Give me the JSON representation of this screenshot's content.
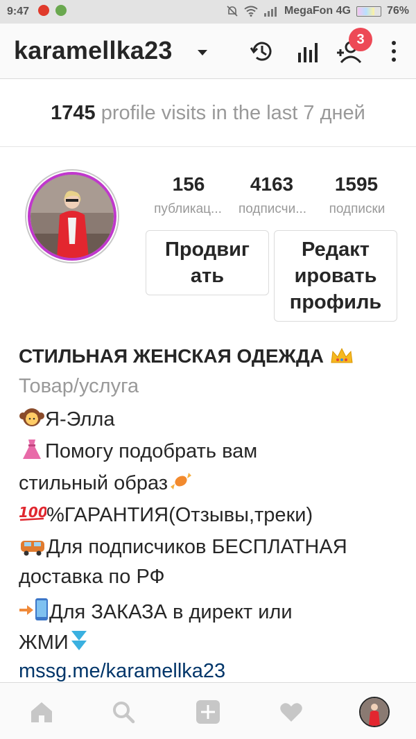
{
  "status_bar": {
    "time": "9:47",
    "carrier": "MegaFon 4G",
    "battery": "76%",
    "icons": [
      "yandex-app-icon",
      "app-icon",
      "mute-icon",
      "wifi-icon",
      "signal-icon",
      "battery-icon"
    ]
  },
  "header": {
    "username": "karamellka23",
    "notification_count": "3",
    "icons": [
      "chevron-down-icon",
      "history-icon",
      "insights-icon",
      "add-user-icon",
      "more-icon"
    ]
  },
  "visits": {
    "count": "1745",
    "text": "profile visits in the last 7 дней"
  },
  "stats": [
    {
      "value": "156",
      "label": "публикац..."
    },
    {
      "value": "4163",
      "label": "подписчи..."
    },
    {
      "value": "1595",
      "label": "подписки"
    }
  ],
  "buttons": {
    "promote_line1": "Продвиг",
    "promote_line2": "ать",
    "edit_line1": "Редакт",
    "edit_line2": "ировать",
    "edit_line3": "профиль"
  },
  "bio": {
    "name": "СТИЛЬНАЯ ЖЕНСКАЯ ОДЕЖДА",
    "category": "Товар/услуга",
    "lines": [
      "Я-Элла",
      "Помогу подобрать вам",
      "стильный образ",
      "%ГАРАНТИЯ(Отзывы,треки)",
      "Для подписчиков БЕСПЛАТНАЯ",
      "доставка по РФ",
      "Для ЗАКАЗА в директ или",
      "ЖМИ"
    ],
    "link": "mssg.me/karamellka23"
  },
  "bottom_nav": [
    "home-icon",
    "search-icon",
    "add-post-icon",
    "heart-icon",
    "profile-avatar"
  ],
  "colors": {
    "accent_ring": "#c038cc",
    "badge": "#ed4956",
    "link": "#003569"
  }
}
